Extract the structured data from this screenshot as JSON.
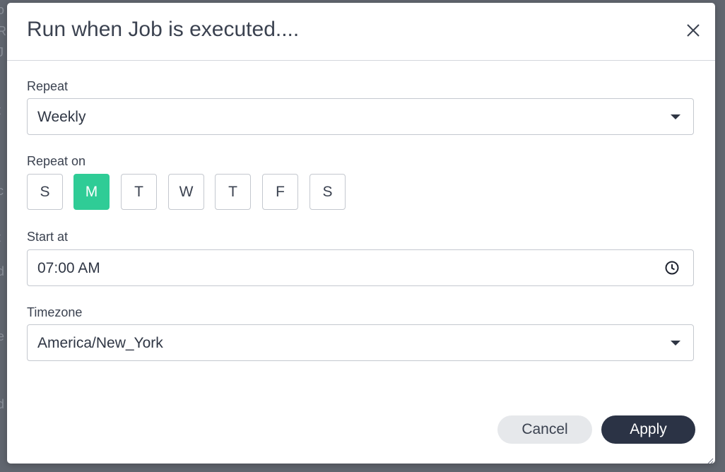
{
  "dialog": {
    "title": "Run when Job is executed....",
    "close_icon": "close-icon"
  },
  "repeat": {
    "label": "Repeat",
    "value": "Weekly"
  },
  "repeat_on": {
    "label": "Repeat on",
    "days": [
      {
        "label": "S",
        "selected": false
      },
      {
        "label": "M",
        "selected": true
      },
      {
        "label": "T",
        "selected": false
      },
      {
        "label": "W",
        "selected": false
      },
      {
        "label": "T",
        "selected": false
      },
      {
        "label": "F",
        "selected": false
      },
      {
        "label": "S",
        "selected": false
      }
    ]
  },
  "start_at": {
    "label": "Start at",
    "value": "07:00 AM",
    "icon": "clock-icon"
  },
  "timezone": {
    "label": "Timezone",
    "value": "America/New_York"
  },
  "actions": {
    "cancel_label": "Cancel",
    "apply_label": "Apply"
  },
  "colors": {
    "selected_day": "#2fcc96",
    "apply_button": "#2b3345",
    "cancel_button": "#e6e8eb"
  }
}
